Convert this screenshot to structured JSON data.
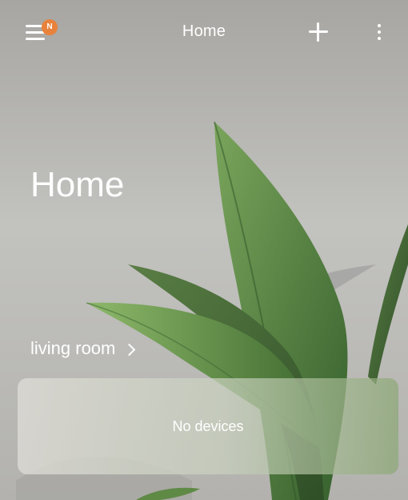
{
  "header": {
    "title": "Home",
    "badge_text": "N",
    "badge_color": "#e8823c"
  },
  "main": {
    "heading": "Home",
    "room_label": "living room",
    "empty_state": "No devices"
  },
  "icons": {
    "menu": "hamburger-icon",
    "add": "plus-icon",
    "more": "vertical-dots-icon",
    "room": "chevron-right-icon"
  },
  "colors": {
    "text": "#ffffff",
    "background": "#b8b8b6",
    "leaf": "#4f7a3c"
  }
}
